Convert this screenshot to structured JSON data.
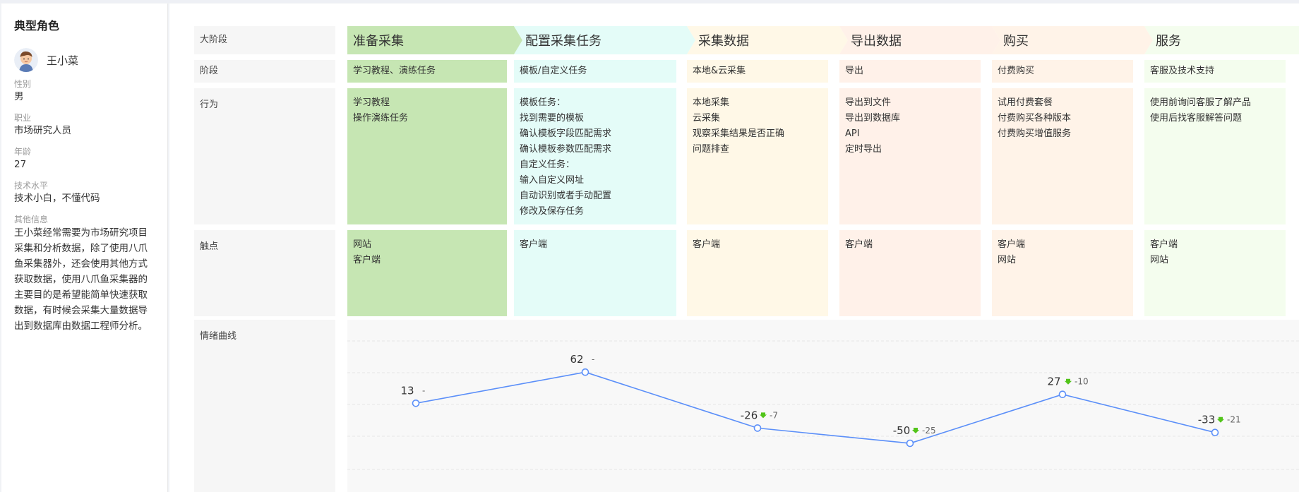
{
  "persona": {
    "section_title": "典型角色",
    "name": "王小菜",
    "fields": {
      "gender_label": "性别",
      "gender": "男",
      "job_label": "职业",
      "job": "市场研究人员",
      "age_label": "年龄",
      "age": "27",
      "skill_label": "技术水平",
      "skill": "技术小白，不懂代码",
      "other_label": "其他信息",
      "other": "王小菜经常需要为市场研究项目采集和分析数据，除了使用八爪鱼采集器外，还会使用其他方式获取数据，使用八爪鱼采集器的主要目的是希望能简单快速获取数据，有时候会采集大量数据导出到数据库由数据工程师分析。"
    }
  },
  "rows": {
    "major_stage": "大阶段",
    "stage": "阶段",
    "behavior": "行为",
    "touchpoint": "触点",
    "emotion": "情绪曲线"
  },
  "stages": [
    {
      "title": "准备采集",
      "color": "#c6e6b3",
      "sub": "学习教程、演练任务",
      "behavior": [
        "学习教程",
        "操作演练任务"
      ],
      "touch": [
        "网站",
        "客户端"
      ]
    },
    {
      "title": "配置采集任务",
      "color": "#e4fcf8",
      "sub": "模板/自定义任务",
      "behavior": [
        "模板任务：",
        "找到需要的模板",
        "确认模板字段匹配需求",
        "确认模板参数匹配需求",
        "自定义任务：",
        "输入自定义网址",
        "自动识别或者手动配置",
        "修改及保存任务"
      ],
      "touch": [
        "客户端"
      ]
    },
    {
      "title": "采集数据",
      "color": "#fff8e7",
      "sub": "本地&云采集",
      "behavior": [
        "本地采集",
        "云采集",
        "观察采集结果是否正确",
        "问题排查"
      ],
      "touch": [
        "客户端"
      ]
    },
    {
      "title": "导出数据",
      "color": "#fff1e9",
      "sub": "导出",
      "behavior": [
        "导出到文件",
        "导出到数据库",
        "API",
        "定时导出"
      ],
      "touch": [
        "客户端"
      ]
    },
    {
      "title": "购买",
      "color": "#fff3e8",
      "sub": "付费购买",
      "behavior": [
        "试用付费套餐",
        "付费购买各种版本",
        "付费购买增值服务"
      ],
      "touch": [
        "客户端",
        "网站"
      ]
    },
    {
      "title": "服务",
      "color": "#f4fdee",
      "sub": "客服及技术支持",
      "behavior": [
        "使用前询问客服了解产品",
        "使用后找客服解答问题"
      ],
      "touch": [
        "客户端",
        "网站"
      ]
    }
  ],
  "chart_data": {
    "type": "line",
    "values": [
      13,
      62,
      -26,
      -50,
      27,
      -33
    ],
    "deltas": [
      "-",
      "-",
      "-7",
      "-25",
      "-10",
      "-21"
    ],
    "ylim": [
      -90,
      90
    ],
    "line_color": "#5b8ff9",
    "down_arrow_color": "#52c41a",
    "grid": true
  },
  "colors": {
    "accent": "#5b8ff9",
    "label_bg": "#f6f6f6"
  }
}
